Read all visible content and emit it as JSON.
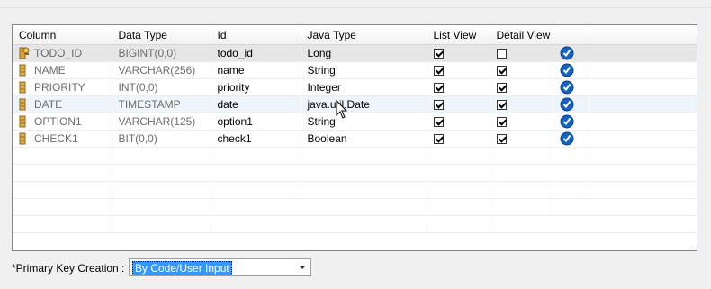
{
  "table": {
    "columns": [
      "Column",
      "Data Type",
      "Id",
      "Java Type",
      "List View",
      "Detail View",
      ""
    ],
    "rows": [
      {
        "column": "TODO_ID",
        "data_type": "BIGINT(0,0)",
        "id": "todo_id",
        "java_type": "Long",
        "list_view": true,
        "detail_view": false,
        "key": true,
        "selected": true
      },
      {
        "column": "NAME",
        "data_type": "VARCHAR(256)",
        "id": "name",
        "java_type": "String",
        "list_view": true,
        "detail_view": true,
        "key": false
      },
      {
        "column": "PRIORITY",
        "data_type": "INT(0,0)",
        "id": "priority",
        "java_type": "Integer",
        "list_view": true,
        "detail_view": true,
        "key": false
      },
      {
        "column": "DATE",
        "data_type": "TIMESTAMP",
        "id": "date",
        "java_type": "java.util.Date",
        "list_view": true,
        "detail_view": true,
        "key": false,
        "hover": true
      },
      {
        "column": "OPTION1",
        "data_type": "VARCHAR(125)",
        "id": "option1",
        "java_type": "String",
        "list_view": true,
        "detail_view": true,
        "key": false
      },
      {
        "column": "CHECK1",
        "data_type": "BIT(0,0)",
        "id": "check1",
        "java_type": "Boolean",
        "list_view": true,
        "detail_view": true,
        "key": false
      }
    ],
    "filler_rows": 5
  },
  "primary_key": {
    "label": "*Primary Key Creation :",
    "value": "By Code/User Input"
  },
  "colors": {
    "badge_blue": "#1565c0",
    "selection_blue": "#3399ff"
  }
}
